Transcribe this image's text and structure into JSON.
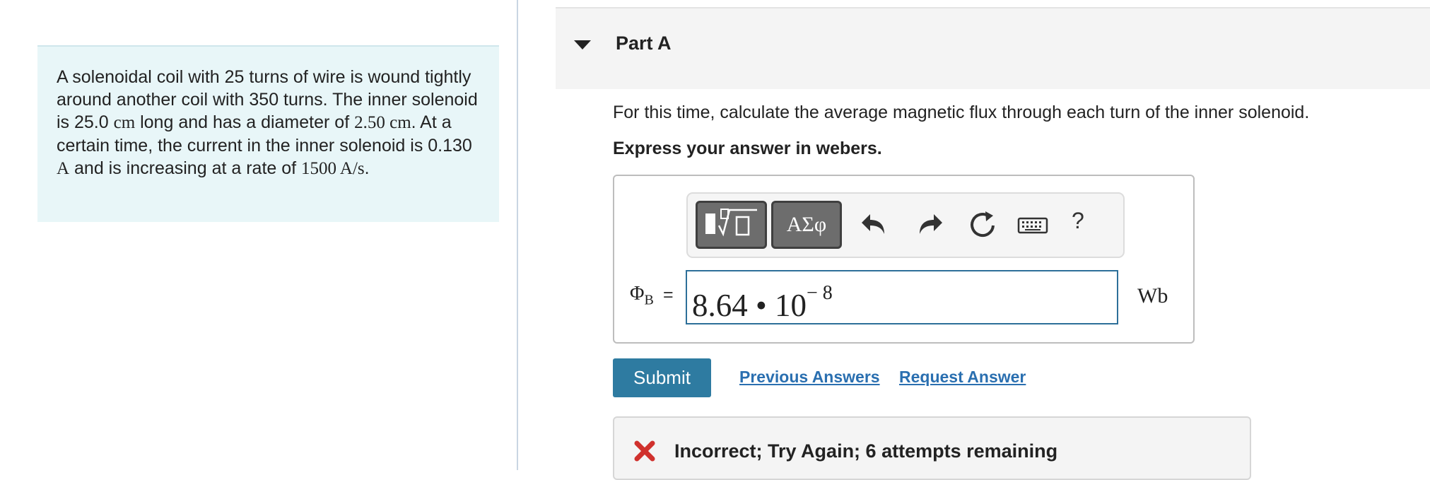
{
  "problem": {
    "text_parts": [
      "A solenoidal coil with 25 turns of wire is wound tightly around another coil with 350 turns. The inner solenoid is 25.0 ",
      "cm",
      " long and has a diameter of ",
      "2.50 cm",
      ". At a certain time, the current in the inner solenoid is 0.130 ",
      "A",
      " and is increasing at a rate of ",
      "1500 A/s",
      "."
    ]
  },
  "part": {
    "title": "Part A",
    "question": "For this time, calculate the average magnetic flux through each turn of the inner solenoid.",
    "instruction": "Express your answer in webers."
  },
  "toolbar": {
    "greek_label": "ΑΣφ",
    "help_label": "?",
    "icons": [
      "templates-icon",
      "greek-letters-icon",
      "undo-icon",
      "redo-icon",
      "reset-icon",
      "keyboard-icon",
      "help-icon"
    ]
  },
  "answer": {
    "symbol": "Φ",
    "symbol_sub": "B",
    "equals": "=",
    "mantissa": "8.64 • 10",
    "exponent": "− 8",
    "unit": "Wb"
  },
  "actions": {
    "submit": "Submit",
    "previous_answers": "Previous Answers",
    "request_answer": "Request Answer"
  },
  "feedback": {
    "message": "Incorrect; Try Again; 6 attempts remaining",
    "color": "#d0312d"
  },
  "colors": {
    "accent": "#2e7ba1",
    "link": "#2a6fb0",
    "panel_bg": "#e8f6f8"
  }
}
